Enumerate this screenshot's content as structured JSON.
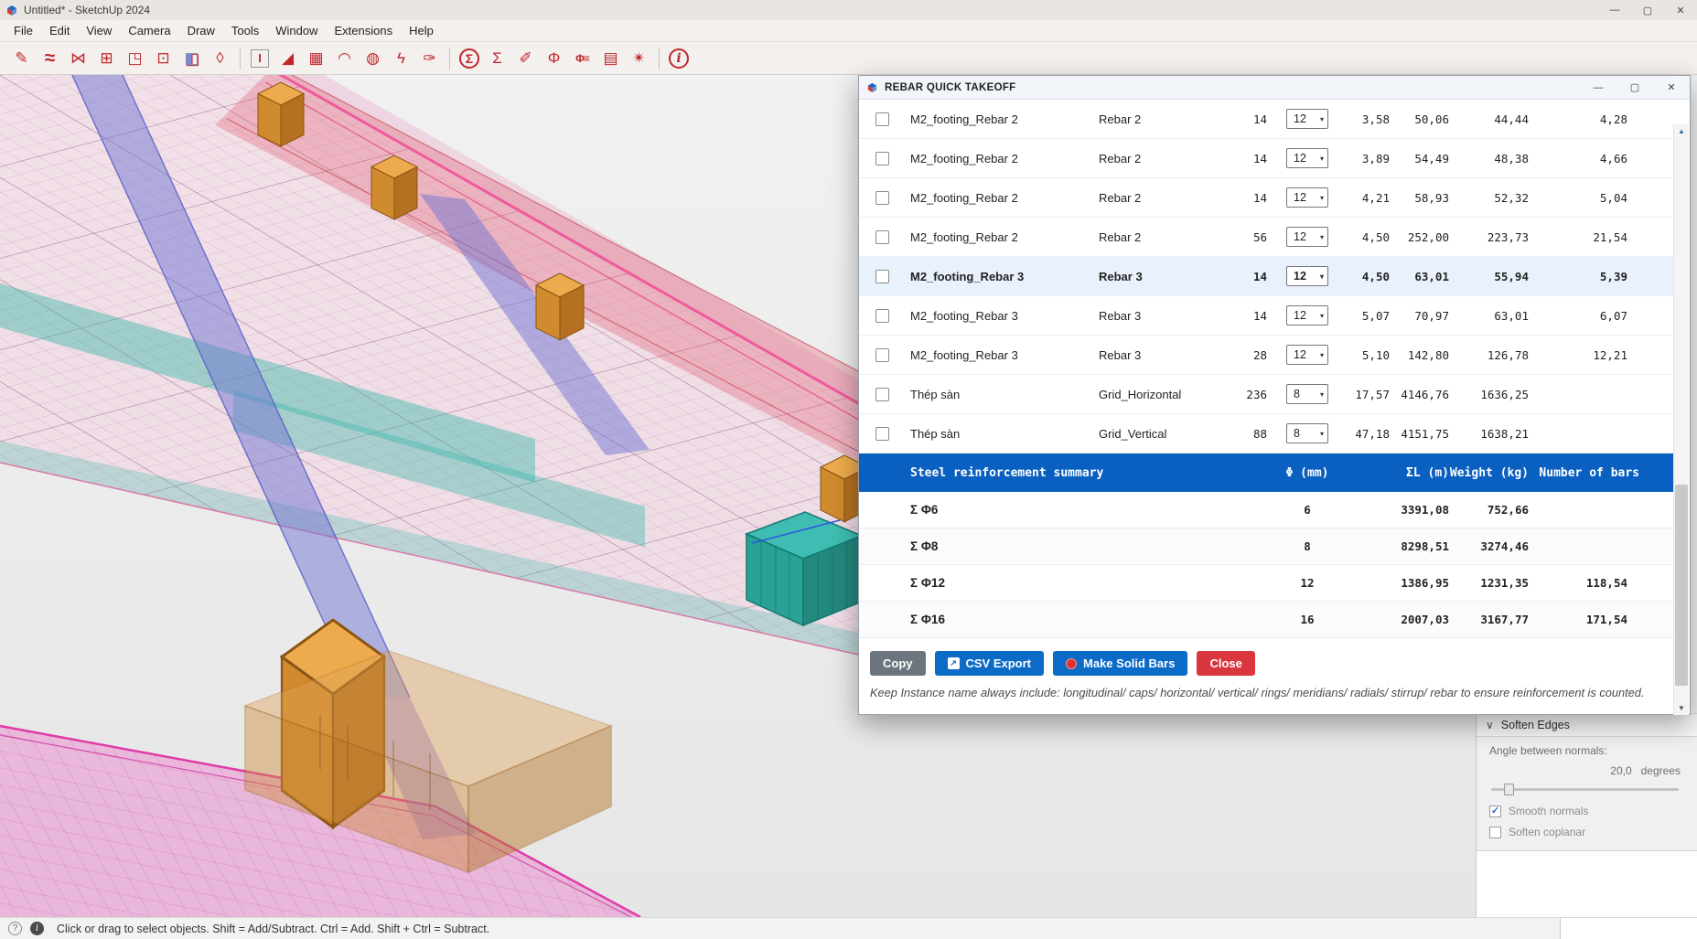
{
  "window": {
    "title": "Untitled* - SketchUp 2024",
    "minimize_glyph": "—",
    "maximize_glyph": "▢",
    "close_glyph": "✕"
  },
  "menu": {
    "items": [
      {
        "label": "File",
        "name": "menu-item-file"
      },
      {
        "label": "Edit",
        "name": "menu-item-edit"
      },
      {
        "label": "View",
        "name": "menu-item-view"
      },
      {
        "label": "Camera",
        "name": "menu-item-camera"
      },
      {
        "label": "Draw",
        "name": "menu-item-draw"
      },
      {
        "label": "Tools",
        "name": "menu-item-tools"
      },
      {
        "label": "Window",
        "name": "menu-item-window"
      },
      {
        "label": "Extensions",
        "name": "menu-item-extensions"
      },
      {
        "label": "Help",
        "name": "menu-item-help"
      }
    ]
  },
  "toolbar": {
    "icons": [
      {
        "glyph": "✎",
        "cls": "tbi",
        "name": "draw-rebar-icon",
        "inter": "true"
      },
      {
        "glyph": "≈",
        "cls": "tbi big",
        "name": "rebar-shape-icon",
        "inter": "true"
      },
      {
        "glyph": "⋈",
        "cls": "tbi",
        "name": "mirror-rebar-icon",
        "inter": "true"
      },
      {
        "glyph": "⊞",
        "cls": "tbi",
        "name": "rebar-array-icon",
        "inter": "true"
      },
      {
        "glyph": "◳",
        "cls": "tbi",
        "name": "corner-bars-icon",
        "inter": "true"
      },
      {
        "glyph": "⊡",
        "cls": "tbi",
        "name": "center-bars-icon",
        "inter": "true"
      },
      {
        "glyph": "◧",
        "cls": "tbi blue",
        "name": "solid-box-icon",
        "inter": "true"
      },
      {
        "glyph": "◊",
        "cls": "tbi",
        "name": "eraser-icon",
        "inter": "true"
      },
      {
        "glyph": "",
        "cls": "tb-sep",
        "name": "toolbar-separator",
        "inter": "false"
      },
      {
        "glyph": "I",
        "cls": "tbi boxed",
        "name": "text-tag-icon",
        "inter": "true"
      },
      {
        "glyph": "◢",
        "cls": "tbi",
        "name": "triangle-mesh-icon",
        "inter": "true"
      },
      {
        "glyph": "▦",
        "cls": "tbi",
        "name": "grid-mesh-icon",
        "inter": "true"
      },
      {
        "glyph": "◠",
        "cls": "tbi",
        "name": "curved-rebar-icon",
        "inter": "true"
      },
      {
        "glyph": "◍",
        "cls": "tbi",
        "name": "dome-mesh-icon",
        "inter": "true"
      },
      {
        "glyph": "ϟ",
        "cls": "tbi",
        "name": "spiral-rebar-icon",
        "inter": "true"
      },
      {
        "glyph": "✑",
        "cls": "tbi",
        "name": "edit-rebar-icon",
        "inter": "true"
      },
      {
        "glyph": "",
        "cls": "tb-sep",
        "name": "toolbar-separator",
        "inter": "false"
      },
      {
        "glyph": "Σ",
        "cls": "tbi circled",
        "name": "rebar-quick-takeoff-icon",
        "inter": "true"
      },
      {
        "glyph": "Ʃ",
        "cls": "tbi",
        "name": "takeoff-selection-icon",
        "inter": "true"
      },
      {
        "glyph": "✐",
        "cls": "tbi",
        "name": "takeoff-edit-icon",
        "inter": "true"
      },
      {
        "glyph": "Φ",
        "cls": "tbi",
        "name": "diameter-mark-icon",
        "inter": "true"
      },
      {
        "glyph": "Φ≡",
        "cls": "tbi small",
        "name": "diameter-list-icon",
        "inter": "true"
      },
      {
        "glyph": "▤",
        "cls": "tbi",
        "name": "schedule-table-icon",
        "inter": "true"
      },
      {
        "glyph": "✴",
        "cls": "tbi",
        "name": "tools-icon",
        "inter": "true"
      },
      {
        "glyph": "",
        "cls": "tb-sep",
        "name": "toolbar-separator",
        "inter": "false"
      },
      {
        "glyph": "i",
        "cls": "tbi circled info",
        "name": "info-icon",
        "inter": "true"
      }
    ]
  },
  "dialog": {
    "title": "REBAR QUICK TAKEOFF",
    "minimize_glyph": "—",
    "maximize_glyph": "▢",
    "close_glyph": "✕",
    "scroll_up_glyph": "▲",
    "scroll_down_glyph": "▼",
    "rows": [
      {
        "name": "M2_footing_Rebar 2",
        "type": "Rebar 2",
        "count": "14",
        "dia": "12",
        "len": "3,58",
        "sum_len": "50,06",
        "weight": "44,44",
        "bars": "4,28",
        "cls": ""
      },
      {
        "name": "M2_footing_Rebar 2",
        "type": "Rebar 2",
        "count": "14",
        "dia": "12",
        "len": "3,89",
        "sum_len": "54,49",
        "weight": "48,38",
        "bars": "4,66",
        "cls": ""
      },
      {
        "name": "M2_footing_Rebar 2",
        "type": "Rebar 2",
        "count": "14",
        "dia": "12",
        "len": "4,21",
        "sum_len": "58,93",
        "weight": "52,32",
        "bars": "5,04",
        "cls": ""
      },
      {
        "name": "M2_footing_Rebar 2",
        "type": "Rebar 2",
        "count": "56",
        "dia": "12",
        "len": "4,50",
        "sum_len": "252,00",
        "weight": "223,73",
        "bars": "21,54",
        "cls": ""
      },
      {
        "name": "M2_footing_Rebar 3",
        "type": "Rebar 3",
        "count": "14",
        "dia": "12",
        "len": "4,50",
        "sum_len": "63,01",
        "weight": "55,94",
        "bars": "5,39",
        "cls": "hl"
      },
      {
        "name": "M2_footing_Rebar 3",
        "type": "Rebar 3",
        "count": "14",
        "dia": "12",
        "len": "5,07",
        "sum_len": "70,97",
        "weight": "63,01",
        "bars": "6,07",
        "cls": ""
      },
      {
        "name": "M2_footing_Rebar 3",
        "type": "Rebar 3",
        "count": "28",
        "dia": "12",
        "len": "5,10",
        "sum_len": "142,80",
        "weight": "126,78",
        "bars": "12,21",
        "cls": ""
      },
      {
        "name": "Thép sàn",
        "type": "Grid_Horizontal",
        "count": "236",
        "dia": "8",
        "len": "17,57",
        "sum_len": "4146,76",
        "weight": "1636,25",
        "bars": "",
        "cls": ""
      },
      {
        "name": "Thép sàn",
        "type": "Grid_Vertical",
        "count": "88",
        "dia": "8",
        "len": "47,18",
        "sum_len": "4151,75",
        "weight": "1638,21",
        "bars": "",
        "cls": ""
      }
    ],
    "summary_header": {
      "label": "Steel reinforcement summary",
      "phi": "Φ (mm)",
      "sigma_l": "ΣL (m)",
      "weight": "Weight (kg)",
      "bars": "Number of bars"
    },
    "summary_rows": [
      {
        "label": "Σ Φ6",
        "phi": "6",
        "sl": "3391,08",
        "w": "752,66",
        "n": "",
        "cls": ""
      },
      {
        "label": "Σ Φ8",
        "phi": "8",
        "sl": "8298,51",
        "w": "3274,46",
        "n": "",
        "cls": "alt"
      },
      {
        "label": "Σ Φ12",
        "phi": "12",
        "sl": "1386,95",
        "w": "1231,35",
        "n": "118,54",
        "cls": ""
      },
      {
        "label": "Σ Φ16",
        "phi": "16",
        "sl": "2007,03",
        "w": "3167,77",
        "n": "171,54",
        "cls": "alt"
      }
    ],
    "buttons": {
      "copy": "Copy",
      "csv": "CSV Export",
      "csv_icon": "↗",
      "solid": "Make Solid Bars",
      "close": "Close"
    },
    "note": "Keep Instance name always include: longitudinal/ caps/ horizontal/ vertical/ rings/ meridians/ radials/ stirrup/ rebar to ensure reinforcement is counted."
  },
  "tray": {
    "soften": {
      "chevron": "∨",
      "title": "Soften Edges",
      "angle_label": "Angle between normals:",
      "angle_value": "20,0",
      "angle_unit": "degrees",
      "check_glyph": "✓",
      "smooth": "Smooth normals",
      "coplanar": "Soften coplanar"
    }
  },
  "status": {
    "help_glyph": "?",
    "info_glyph": "i",
    "text": "Click or drag to select objects. Shift = Add/Subtract. Ctrl = Add. Shift + Ctrl = Subtract."
  },
  "colors": {
    "summary_header_blue": "#0a60c0",
    "button_blue": "#0d6bc8",
    "button_gray": "#6c757d",
    "button_red": "#d9363e",
    "toolbar_icon_red": "#c1272d",
    "highlight_row": "#e9f1fc",
    "slab_pink": "#ef5a9b",
    "lower_slab_magenta": "#e03aa6",
    "beam_purple": "#6f74d2",
    "band_teal": "#3bb9a9",
    "column_orange": "#d18b2f"
  }
}
